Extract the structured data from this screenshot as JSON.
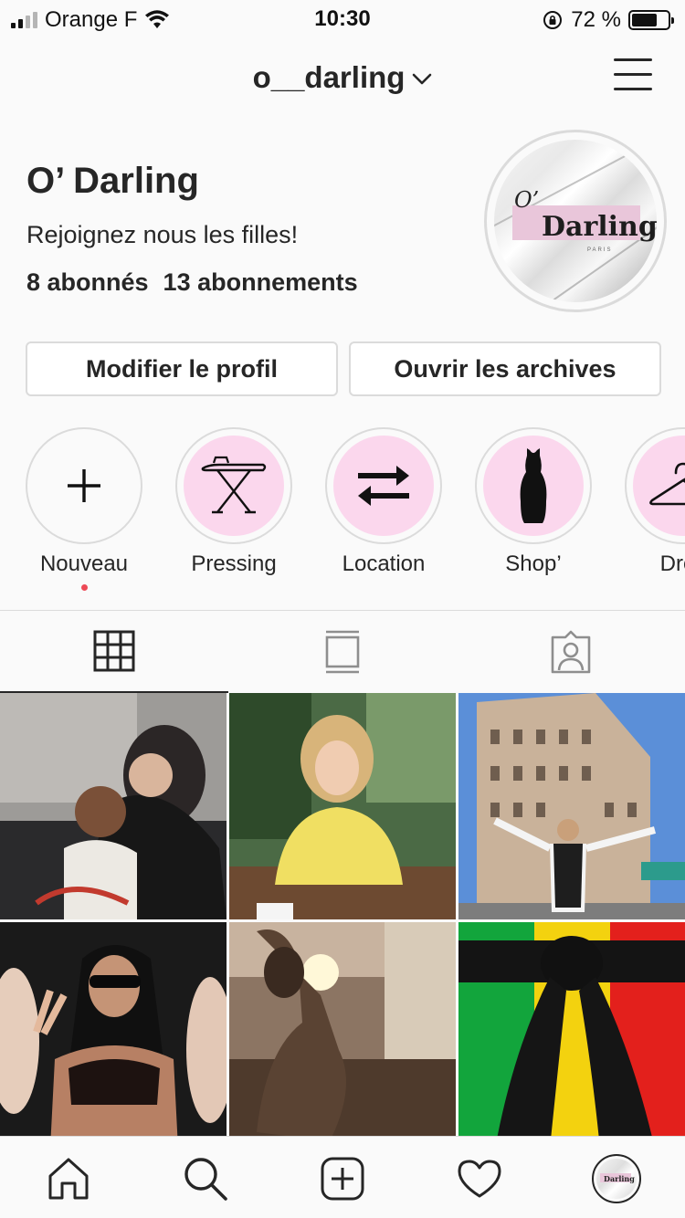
{
  "status_bar": {
    "carrier": "Orange F",
    "time": "10:30",
    "battery_percent": "72 %",
    "battery_level": 0.72
  },
  "header": {
    "username": "o__darling",
    "dropdown_icon": "chevron-down-icon",
    "menu_icon": "hamburger-menu-icon"
  },
  "profile": {
    "name": "O’ Darling",
    "bio": "Rejoignez nous les filles!",
    "followers": "8 abonnés",
    "following": "13 abonnements",
    "avatar": {
      "logo_prefix": "O’",
      "logo_text": "Darling",
      "logo_sub": "PARIS"
    }
  },
  "buttons": {
    "edit_profile": "Modifier le profil",
    "open_archives": "Ouvrir les archives"
  },
  "highlights": [
    {
      "label": "Nouveau",
      "icon": "plus-icon"
    },
    {
      "label": "Pressing",
      "icon": "ironing-board-icon"
    },
    {
      "label": "Location",
      "icon": "swap-arrows-icon"
    },
    {
      "label": "Shop’",
      "icon": "dress-icon"
    },
    {
      "label": "Dres",
      "icon": "hanger-icon"
    }
  ],
  "tabs": [
    {
      "name": "grid",
      "icon": "grid-icon",
      "active": true
    },
    {
      "name": "feed",
      "icon": "feed-icon",
      "active": false
    },
    {
      "name": "tagged",
      "icon": "tagged-person-icon",
      "active": false
    }
  ],
  "posts": [
    {
      "alt": "photo-1"
    },
    {
      "alt": "photo-2"
    },
    {
      "alt": "photo-3"
    },
    {
      "alt": "photo-4"
    },
    {
      "alt": "photo-5"
    },
    {
      "alt": "photo-6"
    }
  ],
  "bottom_nav": [
    {
      "name": "home",
      "icon": "home-icon"
    },
    {
      "name": "search",
      "icon": "search-icon"
    },
    {
      "name": "new-post",
      "icon": "add-post-icon"
    },
    {
      "name": "activity",
      "icon": "heart-icon"
    },
    {
      "name": "profile",
      "icon": "profile-avatar-icon"
    }
  ],
  "colors": {
    "background": "#fafafa",
    "text": "#262626",
    "border": "#dbdbdb",
    "highlight_fill": "#fbd7ed",
    "notification_dot": "#ed4956"
  }
}
